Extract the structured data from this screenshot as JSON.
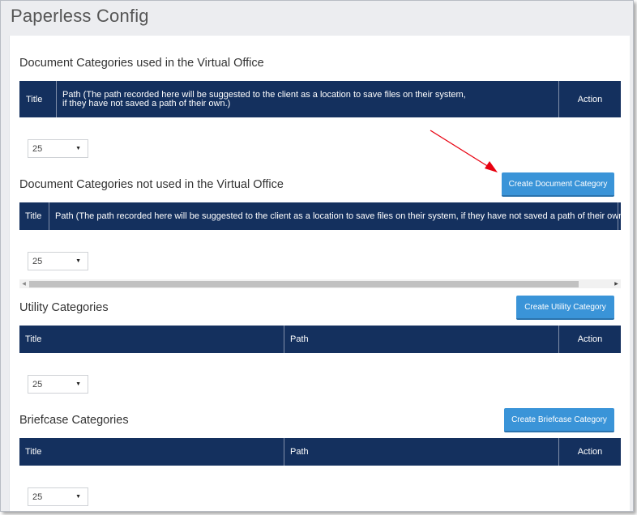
{
  "page": {
    "title": "Paperless Config"
  },
  "sections": {
    "vo_used": {
      "title": "Document Categories used in the Virtual Office",
      "columns": {
        "title": "Title",
        "path_line1": "Path (The path recorded here will be suggested to the client as a location to save files on their system,",
        "path_line2": "if they have not saved a path of their own.)",
        "action": "Action"
      },
      "page_size": "25"
    },
    "vo_not_used": {
      "title": "Document Categories not used in the Virtual Office",
      "button": "Create Document Category",
      "columns": {
        "title": "Title",
        "path": "Path (The path recorded here will be suggested to the client as a location to save files on their system, if they have not saved a path of their own.)"
      },
      "page_size": "25"
    },
    "utility": {
      "title": "Utility Categories",
      "button": "Create Utility Category",
      "columns": {
        "title": "Title",
        "path": "Path",
        "action": "Action"
      },
      "page_size": "25"
    },
    "briefcase": {
      "title": "Briefcase Categories",
      "button": "Create Briefcase Category",
      "columns": {
        "title": "Title",
        "path": "Path",
        "action": "Action"
      },
      "page_size": "25"
    }
  },
  "annotation": {
    "arrow_color": "#e8000f"
  },
  "icons": {
    "select_caret": "caret-down-icon",
    "scroll_left": "scroll-left-icon",
    "scroll_right": "scroll-right-icon"
  }
}
